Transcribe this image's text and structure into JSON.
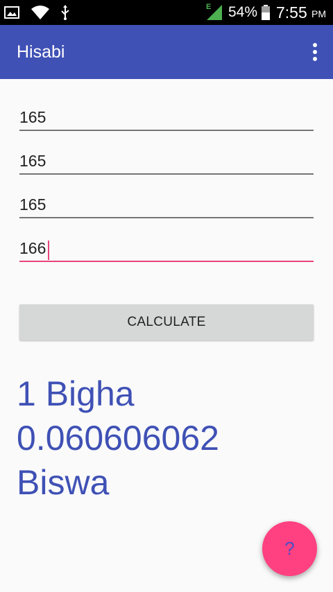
{
  "status_bar": {
    "battery": "54%",
    "time": "7:55",
    "ampm": "PM",
    "network_label": "E",
    "icons": [
      "image-icon",
      "wifi-icon",
      "usb-icon",
      "signal-icon",
      "battery-icon"
    ]
  },
  "app_bar": {
    "title": "Hisabi",
    "menu_icon": "overflow-menu-icon"
  },
  "inputs": [
    {
      "value": "165"
    },
    {
      "value": "165"
    },
    {
      "value": "165"
    },
    {
      "value": "166"
    }
  ],
  "calculate_label": "CALCULATE",
  "result": {
    "line1": "1 Bigha",
    "line2": "0.060606062",
    "line3": "Biswa"
  },
  "fab": {
    "label": "?"
  },
  "colors": {
    "primary": "#3f51b5",
    "accent": "#ff4081",
    "status_bar": "#000000",
    "button": "#d6d7d7"
  }
}
